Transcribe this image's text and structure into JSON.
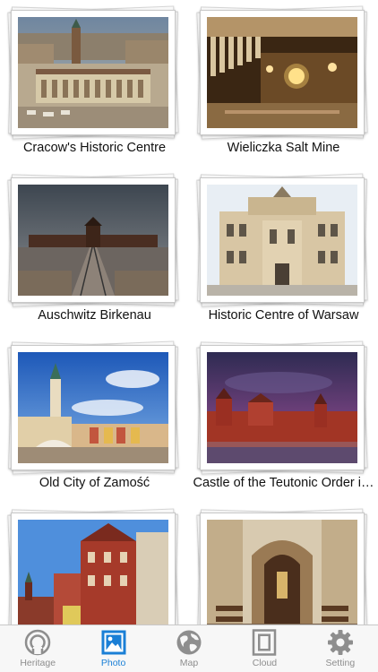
{
  "gallery": {
    "items": [
      {
        "caption": "Cracow's Historic Centre",
        "photo": "cracow-market-square"
      },
      {
        "caption": "Wieliczka Salt Mine",
        "photo": "salt-mine-chapel"
      },
      {
        "caption": "Auschwitz Birkenau",
        "photo": "auschwitz-gate"
      },
      {
        "caption": "Historic Centre of Warsaw",
        "photo": "warsaw-palace"
      },
      {
        "caption": "Old City of Zamość",
        "photo": "zamosc-town-hall"
      },
      {
        "caption": "Castle of the Teutonic Order i…",
        "photo": "malbork-castle"
      },
      {
        "caption": "",
        "photo": "brick-townhouses"
      },
      {
        "caption": "",
        "photo": "church-interior"
      }
    ]
  },
  "tabbar": {
    "tabs": [
      {
        "label": "Heritage",
        "icon": "heritage-icon",
        "active": false
      },
      {
        "label": "Photo",
        "icon": "photo-icon",
        "active": true
      },
      {
        "label": "Map",
        "icon": "globe-icon",
        "active": false
      },
      {
        "label": "Cloud",
        "icon": "cloud-icon",
        "active": false
      },
      {
        "label": "Setting",
        "icon": "gear-icon",
        "active": false
      }
    ]
  },
  "colors": {
    "accent": "#1a7fd6",
    "inactive": "#8e8e8e",
    "tabbar_bg": "#f7f7f7"
  }
}
